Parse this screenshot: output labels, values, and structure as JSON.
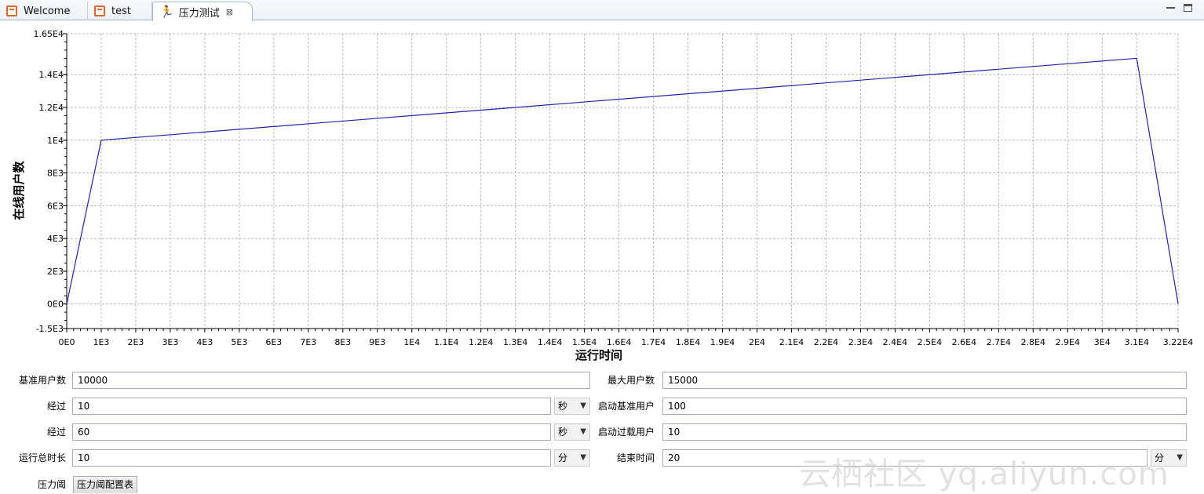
{
  "tabs": [
    {
      "label": "Welcome",
      "icon": "document-icon",
      "active": false
    },
    {
      "label": "test",
      "icon": "document-icon",
      "active": false
    },
    {
      "label": "压力测试",
      "icon": "runner-icon",
      "active": true,
      "close": "⊠"
    }
  ],
  "chart_data": {
    "type": "line",
    "xlabel": "运行时间",
    "ylabel": "在线用户数",
    "xlim": [
      0,
      32200
    ],
    "ylim": [
      -1500,
      16500
    ],
    "x_ticks": [
      "0E0",
      "1E3",
      "2E3",
      "3E3",
      "4E3",
      "5E3",
      "6E3",
      "7E3",
      "8E3",
      "9E3",
      "1E4",
      "1.1E4",
      "1.2E4",
      "1.3E4",
      "1.4E4",
      "1.5E4",
      "1.6E4",
      "1.7E4",
      "1.8E4",
      "1.9E4",
      "2E4",
      "2.1E4",
      "2.2E4",
      "2.3E4",
      "2.4E4",
      "2.5E4",
      "2.6E4",
      "2.7E4",
      "2.8E4",
      "2.9E4",
      "3E4",
      "3.1E4",
      "3.22E4"
    ],
    "y_ticks": [
      {
        "value": -1500,
        "label": "-1.5E3"
      },
      {
        "value": 0,
        "label": "0E0"
      },
      {
        "value": 2000,
        "label": "2E3"
      },
      {
        "value": 4000,
        "label": "4E3"
      },
      {
        "value": 6000,
        "label": "6E3"
      },
      {
        "value": 8000,
        "label": "8E3"
      },
      {
        "value": 10000,
        "label": "1E4"
      },
      {
        "value": 12000,
        "label": "1.2E4"
      },
      {
        "value": 14000,
        "label": "1.4E4"
      },
      {
        "value": 16500,
        "label": "1.65E4"
      }
    ],
    "grid": true,
    "line_color": "#2222aa",
    "series": [
      {
        "x": [
          0,
          1000,
          31000,
          32200
        ],
        "y": [
          0,
          10000,
          15000,
          0
        ]
      }
    ]
  },
  "form": {
    "base_users_label": "基准用户数",
    "base_users_value": "10000",
    "max_users_label": "最大用户数",
    "max_users_value": "15000",
    "ramp1_label": "经过",
    "ramp1_value": "10",
    "ramp1_unit": "秒",
    "start_base_label": "启动基准用户",
    "start_base_value": "100",
    "ramp2_label": "经过",
    "ramp2_value": "60",
    "ramp2_unit": "秒",
    "start_overload_label": "启动过载用户",
    "start_overload_value": "10",
    "total_duration_label": "运行总时长",
    "total_duration_value": "10",
    "total_duration_unit": "分",
    "end_time_label": "结束时间",
    "end_time_value": "20",
    "end_time_unit": "分",
    "threshold_label": "压力阈",
    "threshold_button": "压力阈配置表"
  },
  "watermark": "云栖社区 yq.aliyun.com"
}
